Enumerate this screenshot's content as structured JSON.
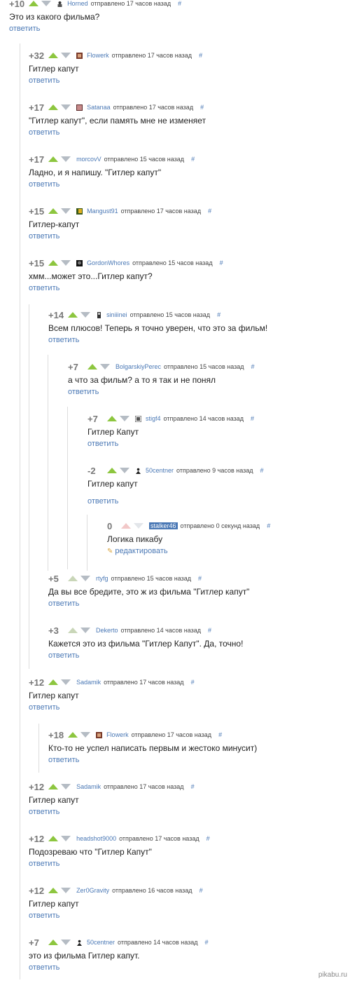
{
  "colors": {
    "up": "#8dc63f",
    "down": "#b5bcc4",
    "link": "#4a78b5"
  },
  "comments": [
    {
      "score": "+10",
      "user": "Horned",
      "time": "отправлено 17 часов назад",
      "hash": "#",
      "text": "Это из какого фильма?",
      "reply": "ответить"
    },
    {
      "score": "+32",
      "user": "Flowerk",
      "time": "отправлено 17 часов назад",
      "hash": "#",
      "text": "Гитлер капут",
      "reply": "ответить"
    },
    {
      "score": "+17",
      "user": "Satanaa",
      "time": "отправлено 17 часов назад",
      "hash": "#",
      "text": "\"Гитлер капут\", если память мне не изменяет",
      "reply": "ответить"
    },
    {
      "score": "+17",
      "user": "morcovV",
      "time": "отправлено 15 часов назад",
      "hash": "#",
      "text": "Ладно, и я напишу. \"Гитлер капут\"",
      "reply": "ответить"
    },
    {
      "score": "+15",
      "user": "Mangust91",
      "time": "отправлено 17 часов назад",
      "hash": "#",
      "text": "Гитлер-капут",
      "reply": "ответить"
    },
    {
      "score": "+15",
      "user": "GordonWhores",
      "time": "отправлено 15 часов назад",
      "hash": "#",
      "text": "хмм...может это...Гитлер капут?",
      "reply": "ответить"
    },
    {
      "score": "+14",
      "user": "siniiinei",
      "time": "отправлено 15 часов назад",
      "hash": "#",
      "text": "Всем плюсов! Теперь я точно уверен, что это за фильм!",
      "reply": "ответить"
    },
    {
      "score": "+7",
      "user": "BolgarskiyPerec",
      "time": "отправлено 15 часов назад",
      "hash": "#",
      "text": "а что за фильм? а то я так и не понял",
      "reply": "ответить"
    },
    {
      "score": "+7",
      "user": "stigf4",
      "time": "отправлено 14 часов назад",
      "hash": "#",
      "text": "Гитлер Капут",
      "reply": "ответить"
    },
    {
      "score": "-2",
      "user": "50centner",
      "time": "отправлено 9 часов назад",
      "hash": "#",
      "text": "Гитлер капут",
      "reply": "ответить"
    },
    {
      "score": "0",
      "user": "stalker46",
      "time": "отправлено 0 секунд назад",
      "hash": "#",
      "text": "Логика пикабу",
      "reply": "редактировать"
    },
    {
      "score": "+5",
      "user": "rtyfg",
      "time": "отправлено 15 часов назад",
      "hash": "#",
      "text": "Да вы все бредите, это ж из фильма \"Гитлер капут\"",
      "reply": "ответить"
    },
    {
      "score": "+3",
      "user": "Dekerto",
      "time": "отправлено 14 часов назад",
      "hash": "#",
      "text": "Кажется это из фильма \"Гитлер Капут\". Да, точно!",
      "reply": "ответить"
    },
    {
      "score": "+12",
      "user": "Sadamik",
      "time": "отправлено 17 часов назад",
      "hash": "#",
      "text": "Гитлер капут",
      "reply": "ответить"
    },
    {
      "score": "+18",
      "user": "Flowerk",
      "time": "отправлено 17 часов назад",
      "hash": "#",
      "text": "Кто-то не успел написать первым и жестоко минусит)",
      "reply": "ответить"
    },
    {
      "score": "+12",
      "user": "Sadamik",
      "time": "отправлено 17 часов назад",
      "hash": "#",
      "text": "Гитлер капут",
      "reply": "ответить"
    },
    {
      "score": "+12",
      "user": "headshot9000",
      "time": "отправлено 17 часов назад",
      "hash": "#",
      "text": "Подозреваю что \"Гитлер Капут\"",
      "reply": "ответить"
    },
    {
      "score": "+12",
      "user": "Zer0Gravity",
      "time": "отправлено 16 часов назад",
      "hash": "#",
      "text": "Гитлер капут",
      "reply": "ответить"
    },
    {
      "score": "+7",
      "user": "50centner",
      "time": "отправлено 14 часов назад",
      "hash": "#",
      "text": "это из фильма Гитлер капут.",
      "reply": "ответить"
    }
  ],
  "watermark": "pikabu.ru"
}
